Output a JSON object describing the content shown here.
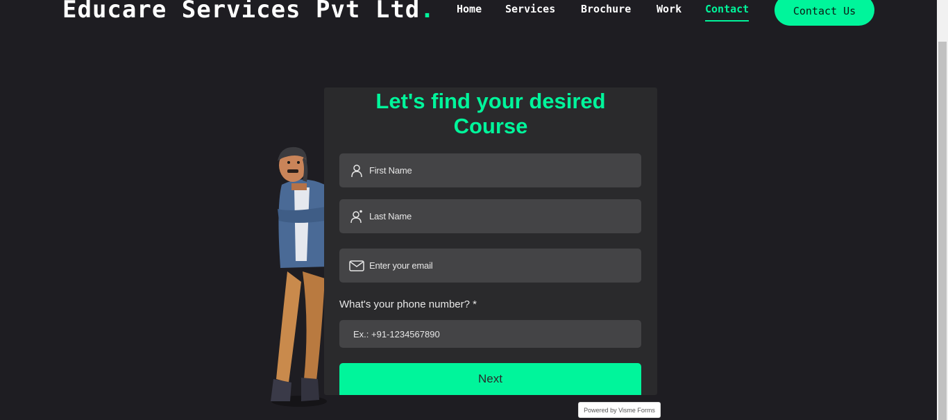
{
  "brand": {
    "name": "Educare Services Pvt Ltd",
    "dot": "."
  },
  "nav": {
    "items": [
      {
        "label": "Home",
        "active": false
      },
      {
        "label": "Services",
        "active": false
      },
      {
        "label": "Brochure",
        "active": false
      },
      {
        "label": "Work",
        "active": false
      },
      {
        "label": "Contact",
        "active": true
      }
    ]
  },
  "cta": {
    "label": "Contact Us"
  },
  "form": {
    "title_line1": "Let's find your desired",
    "title_line2": "Course",
    "first_name_placeholder": "First Name",
    "last_name_placeholder": "Last Name",
    "email_placeholder": "Enter your email",
    "phone_label": "What's your phone number? *",
    "phone_placeholder": "Ex.: +91-1234567890",
    "next_label": "Next"
  },
  "powered_by": "Powered by Visme Forms",
  "colors": {
    "accent": "#00f59b",
    "background": "#1e1d22",
    "card": "#2a2a2c",
    "field": "#444446"
  }
}
